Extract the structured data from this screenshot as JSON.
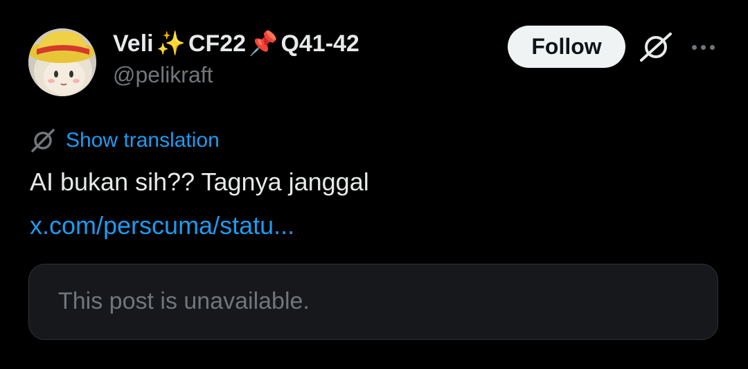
{
  "author": {
    "display_name": "Veli",
    "emoji_1": "✨",
    "tag": "CF22",
    "emoji_2": "📌",
    "location": "Q41-42",
    "handle": "@pelikraft",
    "avatar_icon": "avatar-chibi-with-yellow-hat"
  },
  "actions": {
    "follow_label": "Follow",
    "grok_icon": "grok-icon",
    "more_icon": "more-dots-icon"
  },
  "translation": {
    "icon": "translate-icon",
    "label": "Show translation"
  },
  "post": {
    "text": "AI bukan sih?? Tagnya janggal",
    "link": "x.com/perscuma/statu..."
  },
  "quote": {
    "text": "This post is unavailable."
  },
  "colors": {
    "background": "#000000",
    "primary_text": "#e7e9ea",
    "secondary_text": "#71767b",
    "link": "#1d9bf0",
    "follow_bg": "#eff3f4",
    "quote_bg": "#16181c",
    "quote_border": "#2f3336"
  }
}
